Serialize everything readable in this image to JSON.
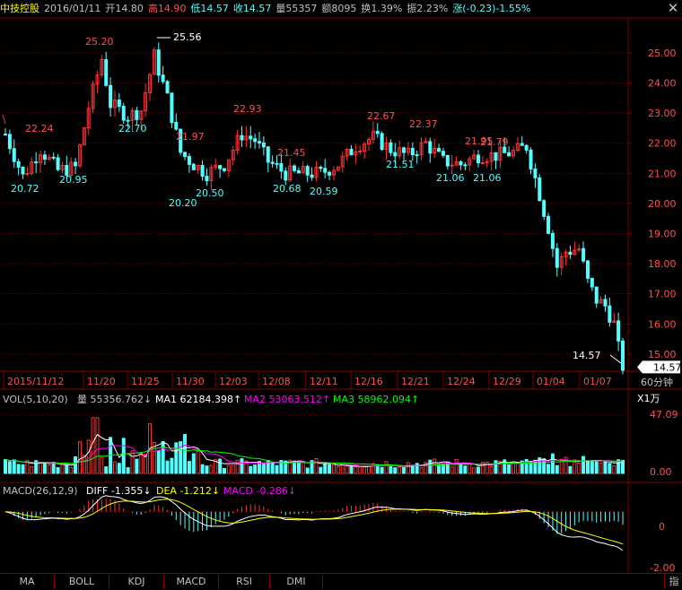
{
  "header": {
    "name": "中技控股",
    "date": "2016/01/11",
    "open": "开14.80",
    "high": "高14.90",
    "low": "低14.57",
    "close": "收14.57",
    "volume": "量55357",
    "amount": "额8095",
    "turnover": "换1.39%",
    "amplitude": "振2.23%",
    "change": "涨(-0.23)-1.55%"
  },
  "close_icon": "close-icon",
  "colors": {
    "up": "#ff3232",
    "down": "#54ffff",
    "grid": "#800000",
    "ma1": "#ffffff",
    "ma2": "#ff00ff",
    "ma3": "#00ff00",
    "dif": "#ffffff",
    "dea": "#ffff00",
    "text_up": "#ff5050",
    "text_down": "#54ffff"
  },
  "period_label": "60分钟",
  "unit_label": "X1万",
  "tabs": [
    "MA",
    "BOLL",
    "KDJ",
    "MACD",
    "RSI",
    "DMI"
  ],
  "end_tab": "指",
  "chart_data": [
    {
      "type": "candlestick",
      "y_ticks": [
        "25.00",
        "24.00",
        "23.00",
        "22.00",
        "21.00",
        "20.00",
        "19.00",
        "18.00",
        "17.00",
        "16.00",
        "15.00"
      ],
      "ylim": [
        14.55,
        26.1
      ],
      "x_ticks": [
        "2015/11/12",
        "11/20",
        "11/25",
        "11/30",
        "12/03",
        "12/08",
        "12/11",
        "12/16",
        "12/21",
        "12/24",
        "12/29",
        "01/04",
        "01/07"
      ],
      "last_price": "14.57",
      "annotations_high": [
        "22.24",
        "25.20",
        "25.56",
        "21.97",
        "22.93",
        "21.45",
        "22.67",
        "22.37",
        "21.95",
        "21.79"
      ],
      "annotations_low": [
        "20.72",
        "20.95",
        "22.70",
        "20.20",
        "20.50",
        "20.68",
        "20.59",
        "21.51",
        "21.06",
        "21.06",
        "14.57"
      ],
      "anchors": [
        {
          "i": 0,
          "v": 22.3
        },
        {
          "i": 4,
          "v": 20.9
        },
        {
          "i": 8,
          "v": 21.8
        },
        {
          "i": 12,
          "v": 21.1
        },
        {
          "i": 16,
          "v": 21.2
        },
        {
          "i": 19,
          "v": 23.2
        },
        {
          "i": 22,
          "v": 24.8
        },
        {
          "i": 24,
          "v": 23.3
        },
        {
          "i": 28,
          "v": 22.9
        },
        {
          "i": 31,
          "v": 23.1
        },
        {
          "i": 34,
          "v": 24.9
        },
        {
          "i": 37,
          "v": 23.5
        },
        {
          "i": 40,
          "v": 21.7
        },
        {
          "i": 43,
          "v": 21.3
        },
        {
          "i": 46,
          "v": 21.0
        },
        {
          "i": 50,
          "v": 21.3
        },
        {
          "i": 54,
          "v": 22.3
        },
        {
          "i": 57,
          "v": 22.1
        },
        {
          "i": 60,
          "v": 21.4
        },
        {
          "i": 64,
          "v": 21.0
        },
        {
          "i": 68,
          "v": 21.0
        },
        {
          "i": 72,
          "v": 21.0
        },
        {
          "i": 76,
          "v": 21.3
        },
        {
          "i": 80,
          "v": 21.9
        },
        {
          "i": 84,
          "v": 22.2
        },
        {
          "i": 88,
          "v": 21.8
        },
        {
          "i": 92,
          "v": 21.6
        },
        {
          "i": 96,
          "v": 22.0
        },
        {
          "i": 100,
          "v": 21.4
        },
        {
          "i": 104,
          "v": 21.3
        },
        {
          "i": 108,
          "v": 21.6
        },
        {
          "i": 112,
          "v": 21.6
        },
        {
          "i": 116,
          "v": 21.7
        },
        {
          "i": 119,
          "v": 21.9
        },
        {
          "i": 122,
          "v": 20.3
        },
        {
          "i": 124,
          "v": 19.2
        },
        {
          "i": 126,
          "v": 17.9
        },
        {
          "i": 128,
          "v": 18.4
        },
        {
          "i": 131,
          "v": 18.5
        },
        {
          "i": 133,
          "v": 17.4
        },
        {
          "i": 135,
          "v": 16.8
        },
        {
          "i": 137,
          "v": 16.6
        },
        {
          "i": 139,
          "v": 16.0
        },
        {
          "i": 140,
          "v": 15.2
        },
        {
          "i": 141,
          "v": 14.6
        }
      ]
    },
    {
      "type": "bar",
      "title": "VOL(5,10,20)",
      "volume_label": "量 55356.762↓",
      "ma1_label": "MA1 62184.398↑",
      "ma2_label": "MA2 53063.512↑",
      "ma3_label": "MA3 58962.094↑",
      "y_ticks": [
        "47.09",
        "0.00"
      ],
      "ylim": [
        0,
        55
      ]
    },
    {
      "type": "bar",
      "title": "MACD(26,12,9)",
      "dif_label": "DIFF -1.355↓",
      "dea_label": "DEA -1.212↓",
      "macd_label": "MACD -0.286↓",
      "y_ticks": [
        "0",
        "-2.00"
      ],
      "ylim": [
        -2.2,
        0.5
      ]
    }
  ]
}
